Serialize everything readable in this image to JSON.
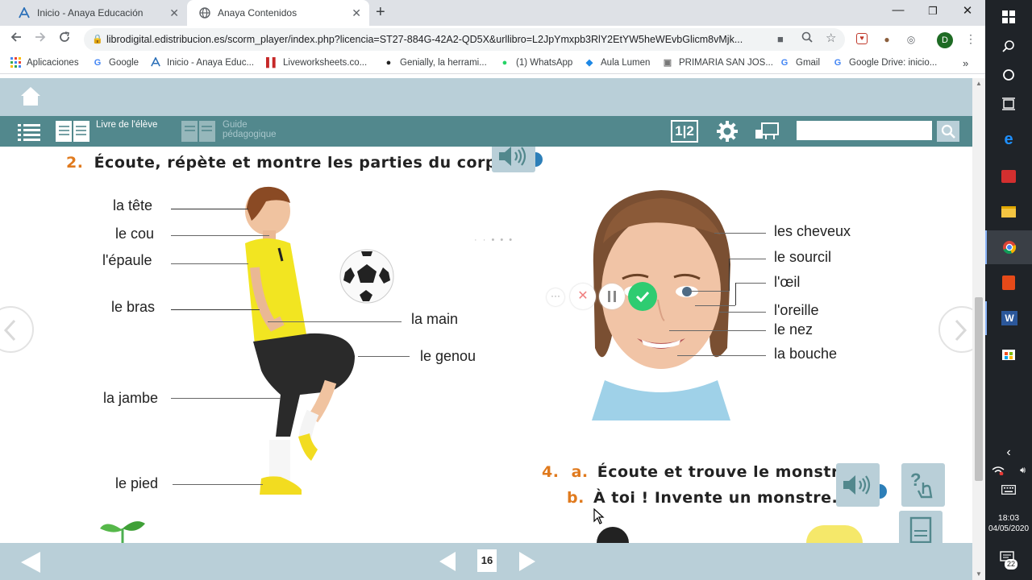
{
  "browser": {
    "tabs": [
      {
        "title": "Inicio - Anaya Educación",
        "active": false
      },
      {
        "title": "Anaya Contenidos",
        "active": true
      }
    ],
    "url": "librodigital.edistribucion.es/scorm_player/index.php?licencia=ST27-884G-42A2-QD5X&urllibro=L2JpYmxpb3RlY2EtYW5heWEvbGlicm8vMjk...",
    "profile_initial": "D",
    "bookmarks": [
      "Aplicaciones",
      "Google",
      "Inicio - Anaya Educ...",
      "Liveworksheets.co...",
      "Genially, la herrami...",
      "(1) WhatsApp",
      "Aula Lumen",
      "PRIMARIA SAN JOS...",
      "Gmail",
      "Google Drive: inicio..."
    ]
  },
  "app": {
    "toolbar": {
      "student_book": "Livre de l'élève",
      "guide_line1": "Guide",
      "guide_line2": "pédagogique",
      "page_mode": "1|2",
      "search_placeholder": ""
    },
    "exercise2": {
      "number": "2.",
      "title": "Écoute, répète et montre les parties du corps.",
      "body_labels": [
        "la tête",
        "le cou",
        "l'épaule",
        "le bras",
        "la main",
        "le genou",
        "la jambe",
        "le pied"
      ],
      "face_labels": [
        "les cheveux",
        "le sourcil",
        "l'œil",
        "l'oreille",
        "le nez",
        "la bouche"
      ]
    },
    "exercise4": {
      "number": "4.",
      "a_letter": "a.",
      "a_text": "Écoute et trouve le monstre.",
      "b_letter": "b.",
      "b_text": "À toi ! Invente un monstre."
    },
    "page_number": "16"
  },
  "taskbar": {
    "time": "18:03",
    "date": "04/05/2020",
    "notifications": "22"
  }
}
